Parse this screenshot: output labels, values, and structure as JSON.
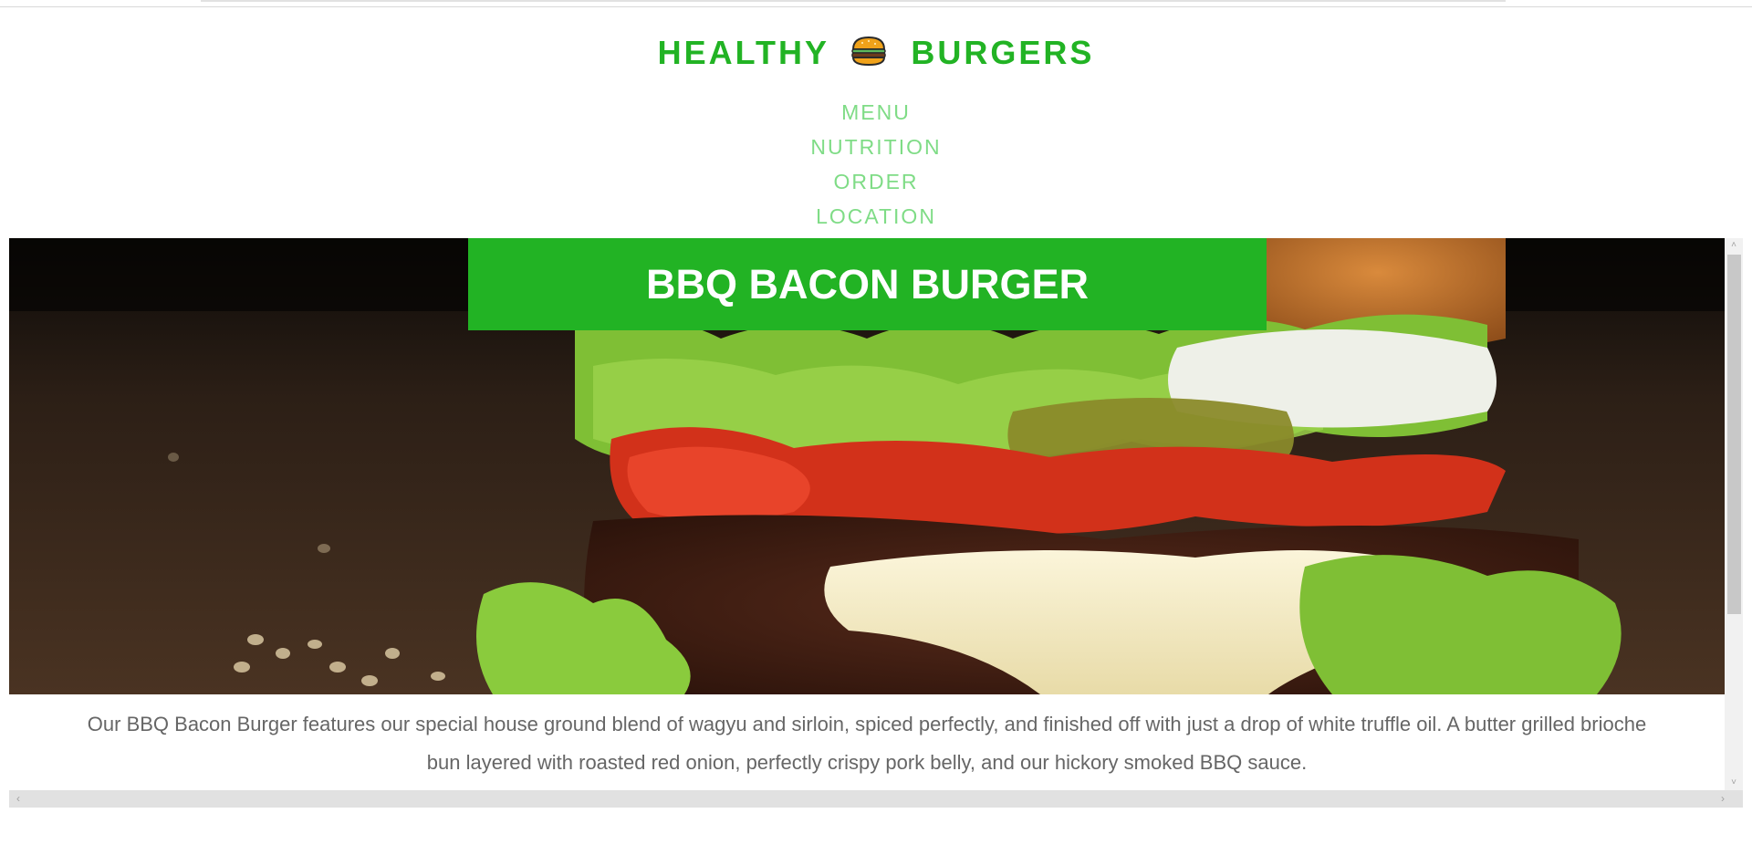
{
  "site": {
    "brand_left": "HEALTHY",
    "brand_right": "BURGERS",
    "brand_icon": "hamburger-icon"
  },
  "nav": {
    "items": [
      {
        "label": "MENU"
      },
      {
        "label": "NUTRITION"
      },
      {
        "label": "ORDER"
      },
      {
        "label": "LOCATION"
      }
    ]
  },
  "hero": {
    "title": "BBQ BACON BURGER",
    "image": "burger-photo"
  },
  "main": {
    "description": "Our BBQ Bacon Burger features our special house ground blend of wagyu and sirloin, spiced perfectly, and finished off with just a drop of white truffle oil. A butter grilled brioche bun layered with roasted red onion, perfectly crispy pork belly, and our hickory smoked BBQ sauce."
  },
  "colors": {
    "brand_green": "#22b324",
    "nav_green": "#7fdc86",
    "body_text": "#666666"
  }
}
